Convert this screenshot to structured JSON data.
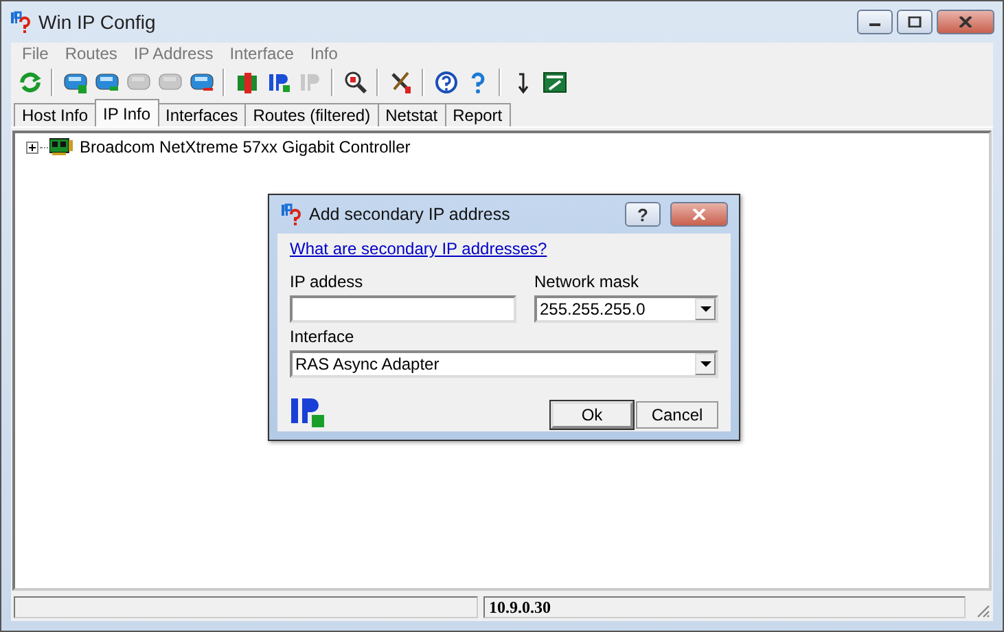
{
  "window": {
    "title": "Win IP Config"
  },
  "menu": [
    "File",
    "Routes",
    "IP Address",
    "Interface",
    "Info"
  ],
  "toolbar": [
    {
      "kind": "refresh",
      "disabled": false
    },
    {
      "kind": "sep"
    },
    {
      "kind": "adapter-add",
      "disabled": false
    },
    {
      "kind": "adapter-edit",
      "disabled": false
    },
    {
      "kind": "adapter",
      "disabled": true
    },
    {
      "kind": "adapter",
      "disabled": true
    },
    {
      "kind": "adapter-remove",
      "disabled": false
    },
    {
      "kind": "sep"
    },
    {
      "kind": "ip-card",
      "disabled": false
    },
    {
      "kind": "ip-add",
      "disabled": false
    },
    {
      "kind": "ip-add",
      "disabled": true
    },
    {
      "kind": "sep"
    },
    {
      "kind": "magnifier",
      "disabled": false
    },
    {
      "kind": "sep"
    },
    {
      "kind": "tools",
      "disabled": false
    },
    {
      "kind": "sep"
    },
    {
      "kind": "help-circle",
      "disabled": false
    },
    {
      "kind": "help",
      "disabled": false
    },
    {
      "kind": "sep"
    },
    {
      "kind": "arrow-down",
      "disabled": false
    },
    {
      "kind": "exit",
      "disabled": false
    }
  ],
  "tabs": [
    {
      "label": "Host Info",
      "selected": false
    },
    {
      "label": "IP Info",
      "selected": true
    },
    {
      "label": "Interfaces",
      "selected": false
    },
    {
      "label": "Routes (filtered)",
      "selected": false
    },
    {
      "label": "Netstat",
      "selected": false
    },
    {
      "label": "Report",
      "selected": false
    }
  ],
  "tree": [
    {
      "label": "Broadcom NetXtreme 57xx Gigabit Controller",
      "expanded": false
    }
  ],
  "dialog": {
    "title": "Add secondary IP address",
    "help_button": "?",
    "link": "What are secondary IP addresses?",
    "ip_address": {
      "label": "IP addess"
    },
    "network_mask": {
      "label": "Network mask",
      "value": "255.255.255.0"
    },
    "interface": {
      "label": "Interface",
      "value": "RAS Async Adapter"
    },
    "buttons": [
      {
        "label": "Ok",
        "selected": true
      },
      {
        "label": "Cancel",
        "selected": false
      }
    ]
  },
  "status_bar": {
    "address": "10.9.0.30"
  }
}
